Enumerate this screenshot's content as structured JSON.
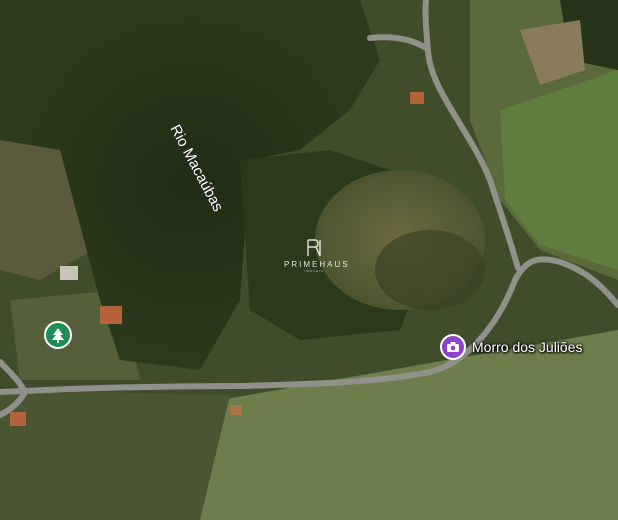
{
  "map": {
    "type": "satellite",
    "colors": {
      "road": "#9a9a95",
      "poi_pin": "#8e44c9",
      "park_pin": "#1e8e57",
      "label": "#ffffff"
    }
  },
  "labels": {
    "river": "Rio Macaúbas",
    "poi": "Morro dos Juliões",
    "watermark_brand": "PRIMEHAUS",
    "watermark_tagline": "IMÓVEIS"
  },
  "icons": {
    "poi_pin": "camera-pin-icon",
    "park_pin": "tree-pin-icon",
    "watermark_logo": "primehaus-logo-icon"
  }
}
